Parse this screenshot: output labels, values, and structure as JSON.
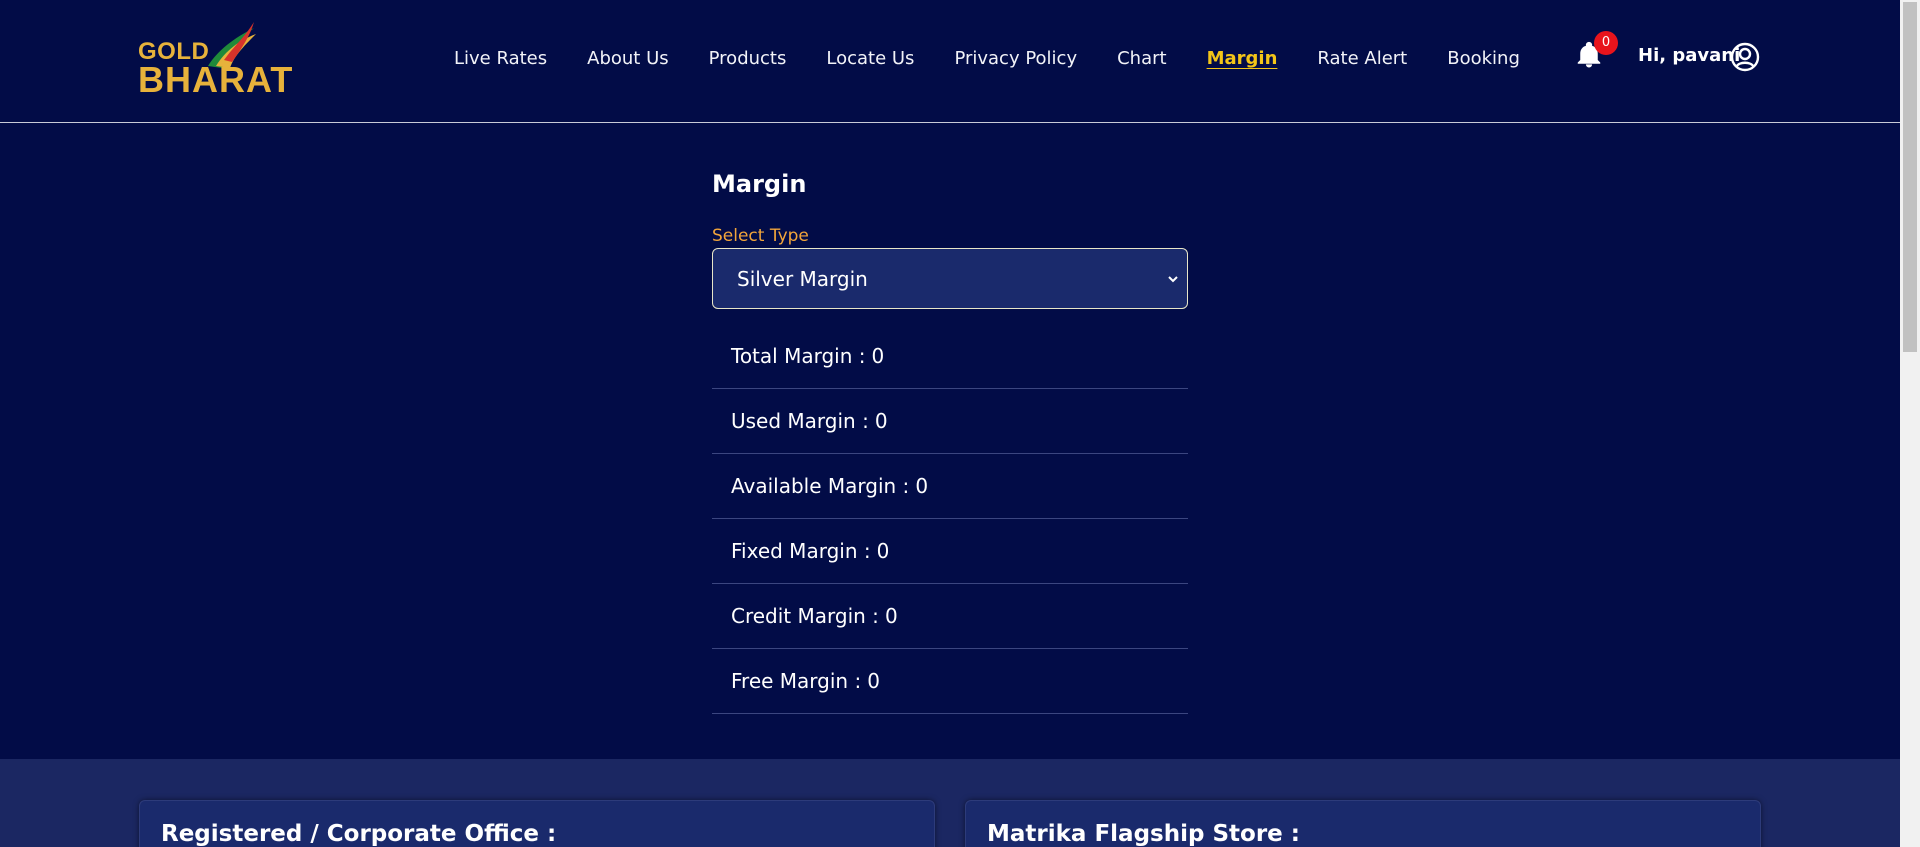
{
  "brand": {
    "line1": "GOLD",
    "line2": "BHARAT",
    "colors": {
      "gold": "#e7b23b",
      "swoosh_green": "#1f8a3a",
      "swoosh_red": "#d8332a"
    }
  },
  "nav": {
    "items": [
      {
        "label": "Live Rates",
        "active": false
      },
      {
        "label": "About Us",
        "active": false
      },
      {
        "label": "Products",
        "active": false
      },
      {
        "label": "Locate Us",
        "active": false
      },
      {
        "label": "Privacy Policy",
        "active": false
      },
      {
        "label": "Chart",
        "active": false
      },
      {
        "label": "Margin",
        "active": true
      },
      {
        "label": "Rate Alert",
        "active": false
      },
      {
        "label": "Booking",
        "active": false
      }
    ],
    "active_color": "#f3c518"
  },
  "header": {
    "notification_count": "0",
    "greeting": "Hi, pavani"
  },
  "main": {
    "title": "Margin",
    "select": {
      "label": "Select Type",
      "value": "Silver Margin"
    },
    "rows": [
      {
        "label": "Total Margin",
        "value": "0"
      },
      {
        "label": "Used Margin",
        "value": "0"
      },
      {
        "label": "Available Margin",
        "value": "0"
      },
      {
        "label": "Fixed Margin",
        "value": "0"
      },
      {
        "label": "Credit Margin",
        "value": "0"
      },
      {
        "label": "Free Margin",
        "value": "0"
      }
    ]
  },
  "footer": {
    "cards": [
      {
        "title": "Registered / Corporate Office :"
      },
      {
        "title": "Matrika Flagship Store :"
      }
    ]
  },
  "colors": {
    "background": "#020c47",
    "footer_background": "#1b2762",
    "label_accent": "#f2a53b",
    "badge": "#e8141c"
  }
}
